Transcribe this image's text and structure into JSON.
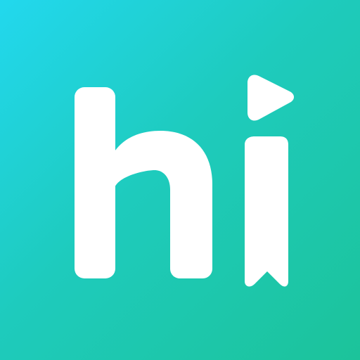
{
  "icon": {
    "name": "hi app logo",
    "logo_text": "hi",
    "colors": {
      "gradient_start": "#22d8ee",
      "gradient_mid": "#1ecbbd",
      "gradient_end": "#1cc39a",
      "glyph": "#ffffff"
    },
    "glyphs": {
      "letter_h": "h-letter-icon",
      "letter_i_stem": "bookmark-icon",
      "letter_i_dot": "play-icon"
    }
  }
}
